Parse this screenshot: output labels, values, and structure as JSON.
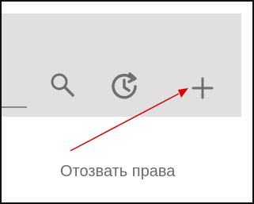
{
  "toolbar": {
    "icons": [
      "search-icon",
      "refresh-icon",
      "plus-icon"
    ]
  },
  "menu": {
    "revoke_label": "Отозвать права"
  },
  "colors": {
    "toolbar_bg": "#e0e0e0",
    "icon_color": "#6f6f6f",
    "text_color": "#6b6b6b",
    "annotation_arrow": "#e00000",
    "frame_border": "#111111"
  }
}
